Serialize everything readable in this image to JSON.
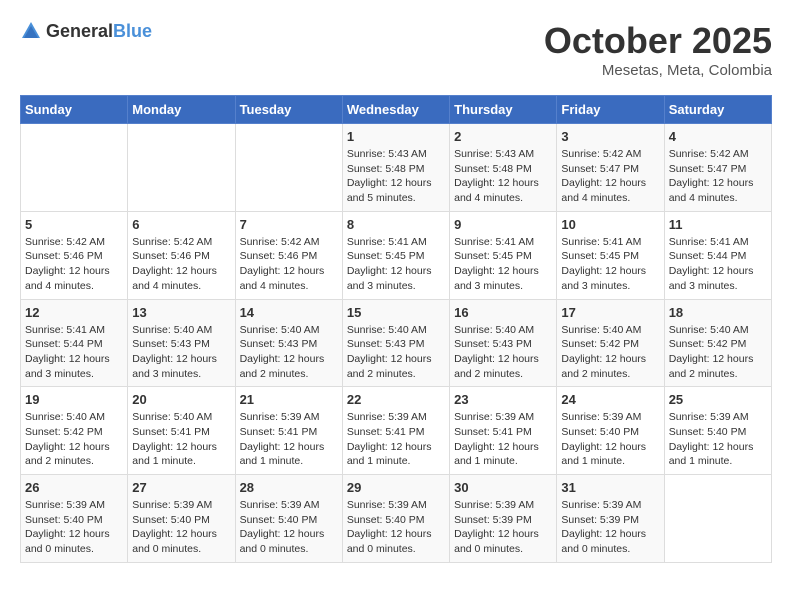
{
  "logo": {
    "general": "General",
    "blue": "Blue"
  },
  "title": "October 2025",
  "location": "Mesetas, Meta, Colombia",
  "days_of_week": [
    "Sunday",
    "Monday",
    "Tuesday",
    "Wednesday",
    "Thursday",
    "Friday",
    "Saturday"
  ],
  "weeks": [
    [
      {
        "day": "",
        "info": ""
      },
      {
        "day": "",
        "info": ""
      },
      {
        "day": "",
        "info": ""
      },
      {
        "day": "1",
        "info": "Sunrise: 5:43 AM\nSunset: 5:48 PM\nDaylight: 12 hours\nand 5 minutes."
      },
      {
        "day": "2",
        "info": "Sunrise: 5:43 AM\nSunset: 5:48 PM\nDaylight: 12 hours\nand 4 minutes."
      },
      {
        "day": "3",
        "info": "Sunrise: 5:42 AM\nSunset: 5:47 PM\nDaylight: 12 hours\nand 4 minutes."
      },
      {
        "day": "4",
        "info": "Sunrise: 5:42 AM\nSunset: 5:47 PM\nDaylight: 12 hours\nand 4 minutes."
      }
    ],
    [
      {
        "day": "5",
        "info": "Sunrise: 5:42 AM\nSunset: 5:46 PM\nDaylight: 12 hours\nand 4 minutes."
      },
      {
        "day": "6",
        "info": "Sunrise: 5:42 AM\nSunset: 5:46 PM\nDaylight: 12 hours\nand 4 minutes."
      },
      {
        "day": "7",
        "info": "Sunrise: 5:42 AM\nSunset: 5:46 PM\nDaylight: 12 hours\nand 4 minutes."
      },
      {
        "day": "8",
        "info": "Sunrise: 5:41 AM\nSunset: 5:45 PM\nDaylight: 12 hours\nand 3 minutes."
      },
      {
        "day": "9",
        "info": "Sunrise: 5:41 AM\nSunset: 5:45 PM\nDaylight: 12 hours\nand 3 minutes."
      },
      {
        "day": "10",
        "info": "Sunrise: 5:41 AM\nSunset: 5:45 PM\nDaylight: 12 hours\nand 3 minutes."
      },
      {
        "day": "11",
        "info": "Sunrise: 5:41 AM\nSunset: 5:44 PM\nDaylight: 12 hours\nand 3 minutes."
      }
    ],
    [
      {
        "day": "12",
        "info": "Sunrise: 5:41 AM\nSunset: 5:44 PM\nDaylight: 12 hours\nand 3 minutes."
      },
      {
        "day": "13",
        "info": "Sunrise: 5:40 AM\nSunset: 5:43 PM\nDaylight: 12 hours\nand 3 minutes."
      },
      {
        "day": "14",
        "info": "Sunrise: 5:40 AM\nSunset: 5:43 PM\nDaylight: 12 hours\nand 2 minutes."
      },
      {
        "day": "15",
        "info": "Sunrise: 5:40 AM\nSunset: 5:43 PM\nDaylight: 12 hours\nand 2 minutes."
      },
      {
        "day": "16",
        "info": "Sunrise: 5:40 AM\nSunset: 5:43 PM\nDaylight: 12 hours\nand 2 minutes."
      },
      {
        "day": "17",
        "info": "Sunrise: 5:40 AM\nSunset: 5:42 PM\nDaylight: 12 hours\nand 2 minutes."
      },
      {
        "day": "18",
        "info": "Sunrise: 5:40 AM\nSunset: 5:42 PM\nDaylight: 12 hours\nand 2 minutes."
      }
    ],
    [
      {
        "day": "19",
        "info": "Sunrise: 5:40 AM\nSunset: 5:42 PM\nDaylight: 12 hours\nand 2 minutes."
      },
      {
        "day": "20",
        "info": "Sunrise: 5:40 AM\nSunset: 5:41 PM\nDaylight: 12 hours\nand 1 minute."
      },
      {
        "day": "21",
        "info": "Sunrise: 5:39 AM\nSunset: 5:41 PM\nDaylight: 12 hours\nand 1 minute."
      },
      {
        "day": "22",
        "info": "Sunrise: 5:39 AM\nSunset: 5:41 PM\nDaylight: 12 hours\nand 1 minute."
      },
      {
        "day": "23",
        "info": "Sunrise: 5:39 AM\nSunset: 5:41 PM\nDaylight: 12 hours\nand 1 minute."
      },
      {
        "day": "24",
        "info": "Sunrise: 5:39 AM\nSunset: 5:40 PM\nDaylight: 12 hours\nand 1 minute."
      },
      {
        "day": "25",
        "info": "Sunrise: 5:39 AM\nSunset: 5:40 PM\nDaylight: 12 hours\nand 1 minute."
      }
    ],
    [
      {
        "day": "26",
        "info": "Sunrise: 5:39 AM\nSunset: 5:40 PM\nDaylight: 12 hours\nand 0 minutes."
      },
      {
        "day": "27",
        "info": "Sunrise: 5:39 AM\nSunset: 5:40 PM\nDaylight: 12 hours\nand 0 minutes."
      },
      {
        "day": "28",
        "info": "Sunrise: 5:39 AM\nSunset: 5:40 PM\nDaylight: 12 hours\nand 0 minutes."
      },
      {
        "day": "29",
        "info": "Sunrise: 5:39 AM\nSunset: 5:40 PM\nDaylight: 12 hours\nand 0 minutes."
      },
      {
        "day": "30",
        "info": "Sunrise: 5:39 AM\nSunset: 5:39 PM\nDaylight: 12 hours\nand 0 minutes."
      },
      {
        "day": "31",
        "info": "Sunrise: 5:39 AM\nSunset: 5:39 PM\nDaylight: 12 hours\nand 0 minutes."
      },
      {
        "day": "",
        "info": ""
      }
    ]
  ]
}
